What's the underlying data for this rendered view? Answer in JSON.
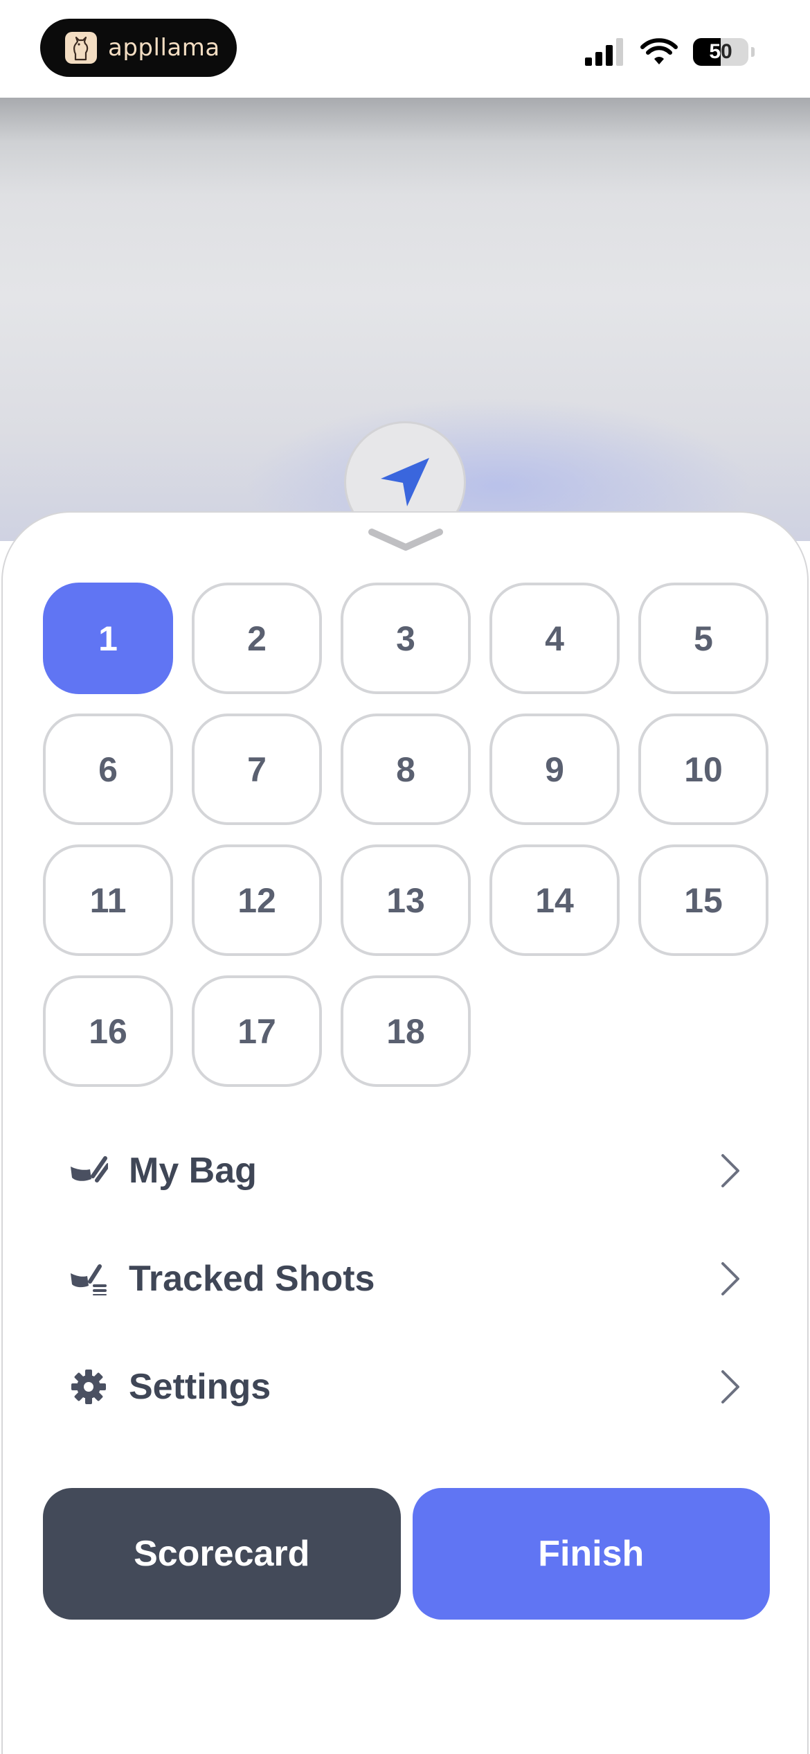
{
  "status_bar": {
    "app_name": "appllama",
    "battery_level": "50",
    "battery_fraction": 0.5,
    "signal_icon": "cellular-signal-icon",
    "wifi_icon": "wifi-icon"
  },
  "map": {
    "locate_icon": "navigation-arrow-icon"
  },
  "sheet": {
    "handle_icon": "chevron-down-icon",
    "holes": [
      "1",
      "2",
      "3",
      "4",
      "5",
      "6",
      "7",
      "8",
      "9",
      "10",
      "11",
      "12",
      "13",
      "14",
      "15",
      "16",
      "17",
      "18"
    ],
    "selected_hole": "1",
    "menu": [
      {
        "label": "My Bag",
        "icon": "golf-club-icon"
      },
      {
        "label": "Tracked Shots",
        "icon": "tracked-shots-icon"
      },
      {
        "label": "Settings",
        "icon": "gear-icon"
      }
    ],
    "scorecard_label": "Scorecard",
    "finish_label": "Finish"
  },
  "colors": {
    "accent": "#6075f3",
    "dark_button": "#434a59",
    "text": "#3f4656",
    "locate_arrow": "#3a66dd"
  }
}
